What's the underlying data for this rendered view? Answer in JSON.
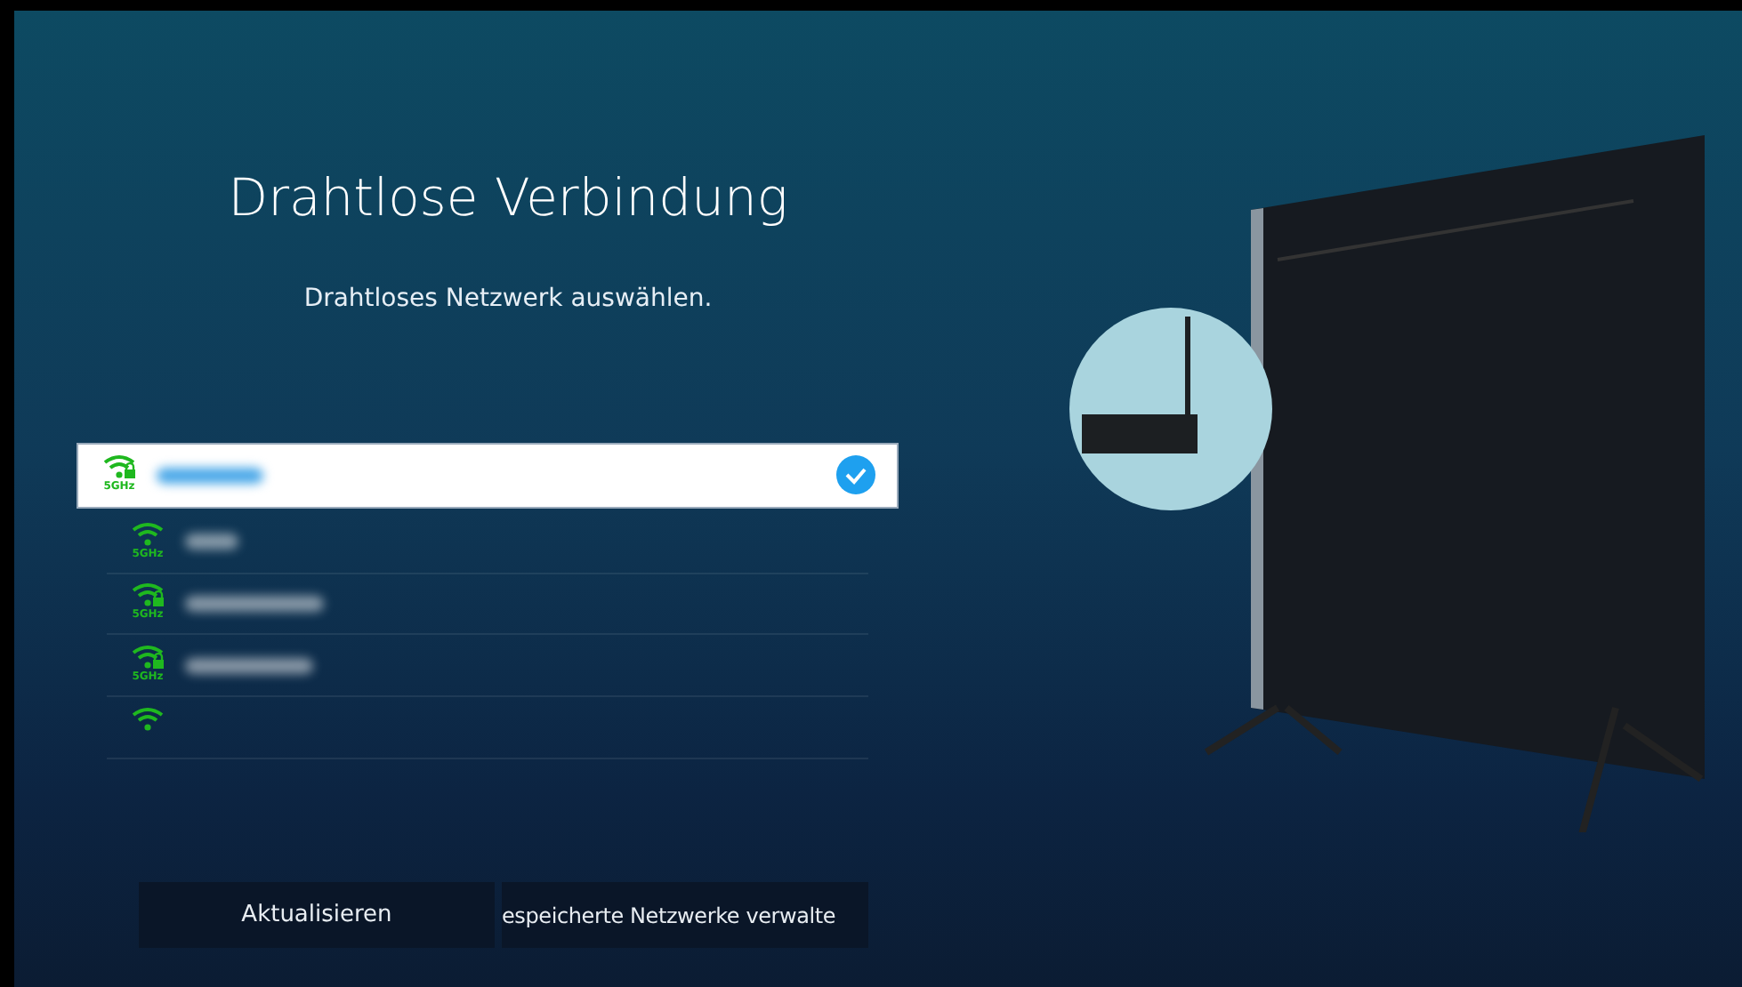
{
  "title": "Drahtlose Verbindung",
  "subtitle": "Drahtloses Netzwerk auswählen.",
  "networks": [
    {
      "band": "5GHz",
      "locked": true,
      "selected": true
    },
    {
      "band": "5GHz",
      "locked": false,
      "selected": false
    },
    {
      "band": "5GHz",
      "locked": true,
      "selected": false
    },
    {
      "band": "5GHz",
      "locked": true,
      "selected": false
    },
    {
      "locked": false,
      "selected": false
    }
  ],
  "buttons": [
    "Aktualisieren",
    "espeicherte Netzwerke verwalte"
  ]
}
